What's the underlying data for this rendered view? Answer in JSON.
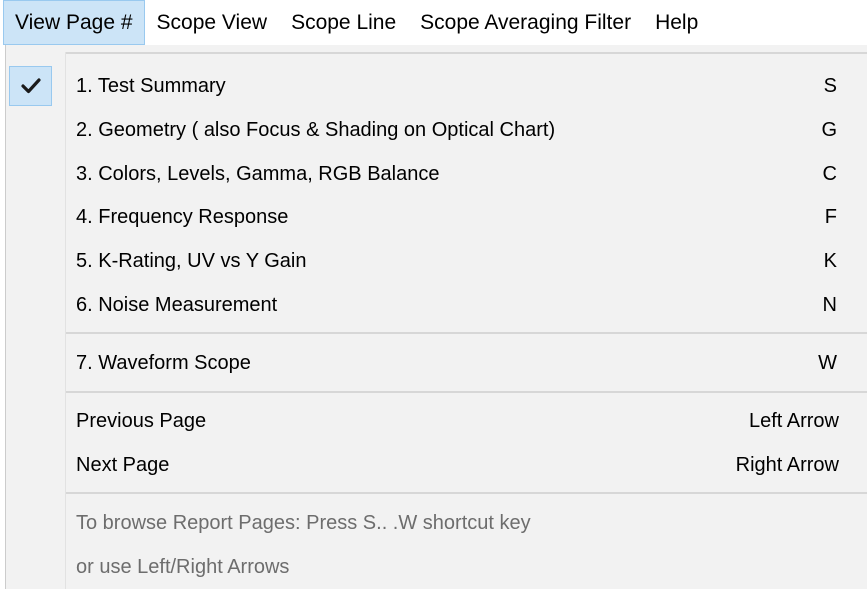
{
  "menubar": {
    "items": [
      {
        "label": "View Page #",
        "active": true
      },
      {
        "label": "Scope View",
        "active": false
      },
      {
        "label": "Scope Line",
        "active": false
      },
      {
        "label": "Scope Averaging Filter",
        "active": false
      },
      {
        "label": "Help",
        "active": false
      }
    ]
  },
  "dropdown": {
    "checked_item": "1. Test Summary",
    "page_items": [
      {
        "label": "1. Test Summary",
        "shortcut": "S"
      },
      {
        "label": "2. Geometry ( also Focus & Shading on Optical Chart)",
        "shortcut": "G"
      },
      {
        "label": "3. Colors,  Levels, Gamma, RGB Balance",
        "shortcut": "C"
      },
      {
        "label": "4. Frequency Response",
        "shortcut": "F"
      },
      {
        "label": "5. K-Rating, UV vs Y Gain",
        "shortcut": "K"
      },
      {
        "label": "6. Noise Measurement",
        "shortcut": "N"
      }
    ],
    "scope_item": {
      "label": "7. Waveform Scope",
      "shortcut": "W"
    },
    "nav_items": [
      {
        "label": "Previous Page",
        "shortcut": "Left Arrow"
      },
      {
        "label": "Next Page",
        "shortcut": "Right Arrow"
      }
    ],
    "hint_lines": [
      "To browse Report Pages: Press S.. .W shortcut key",
      "or use  Left/Right Arrows"
    ]
  },
  "icons": {
    "checkmark": "checkmark-icon"
  },
  "colors": {
    "highlight_fill": "#cce4f7",
    "highlight_border": "#99c9ef",
    "menu_background": "#f2f2f2",
    "disabled_text": "#6d6d6d"
  }
}
